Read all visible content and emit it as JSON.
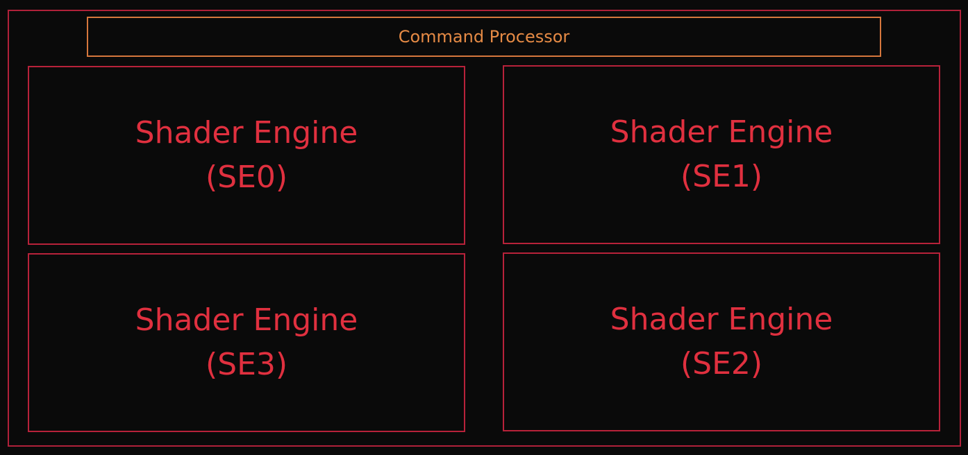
{
  "diagram": {
    "command_processor": {
      "label": "Command Processor"
    },
    "shader_engines": [
      {
        "title": "Shader Engine",
        "id": "(SE0)"
      },
      {
        "title": "Shader Engine",
        "id": "(SE1)"
      },
      {
        "title": "Shader Engine",
        "id": "(SE3)"
      },
      {
        "title": "Shader Engine",
        "id": "(SE2)"
      }
    ]
  },
  "colors": {
    "background": "#0a0a0a",
    "border_red": "#b8223a",
    "text_red": "#e0303f",
    "orange": "#e58a45"
  }
}
